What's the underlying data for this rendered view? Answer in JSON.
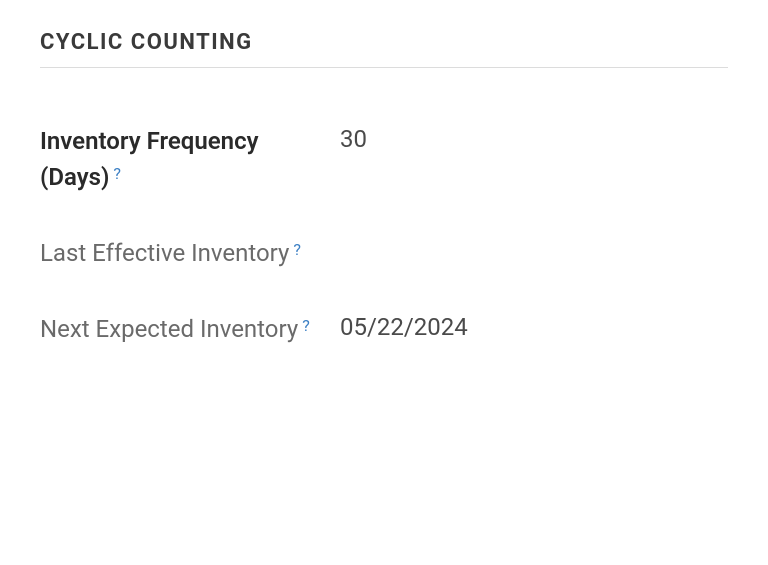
{
  "section": {
    "title": "CYCLIC COUNTING",
    "fields": [
      {
        "label": "Inventory Frequency (Days)",
        "value": "30",
        "help": "?"
      },
      {
        "label": "Last Effective Inventory",
        "value": "",
        "help": "?"
      },
      {
        "label": "Next Expected Inventory",
        "value": "05/22/2024",
        "help": "?"
      }
    ]
  }
}
